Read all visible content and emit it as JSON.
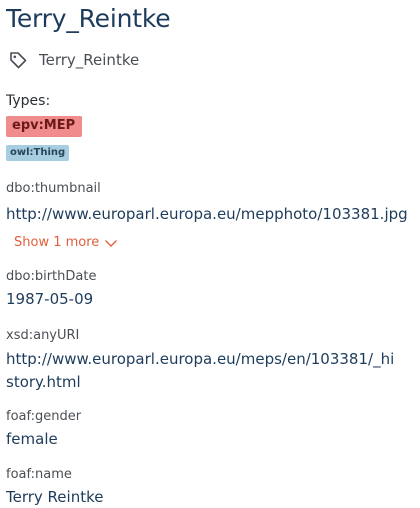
{
  "entity": {
    "title": "Terry_Reintke",
    "label": "Terry_Reintke"
  },
  "types": {
    "heading": "Types:",
    "items": [
      {
        "label": "epv:MEP",
        "color": "#f08c8c"
      },
      {
        "label": "owl:Thing",
        "color": "#a6cde0"
      }
    ]
  },
  "properties": [
    {
      "name": "dbo:thumbnail",
      "value": "http://www.europarl.europa.eu/mepphoto/103381.jpg",
      "show_more": "Show 1 more"
    },
    {
      "name": "dbo:birthDate",
      "value": "1987-05-09"
    },
    {
      "name": "xsd:anyURI",
      "value": "http://www.europarl.europa.eu/meps/en/103381/_history.html"
    },
    {
      "name": "foaf:gender",
      "value": "female"
    },
    {
      "name": "foaf:name",
      "value": "Terry Reintke"
    }
  ],
  "icons": {
    "label": "tag-icon",
    "show_more": "chevron-down-icon"
  },
  "colors": {
    "title": "#1d3c5c",
    "accent": "#e0603c"
  }
}
